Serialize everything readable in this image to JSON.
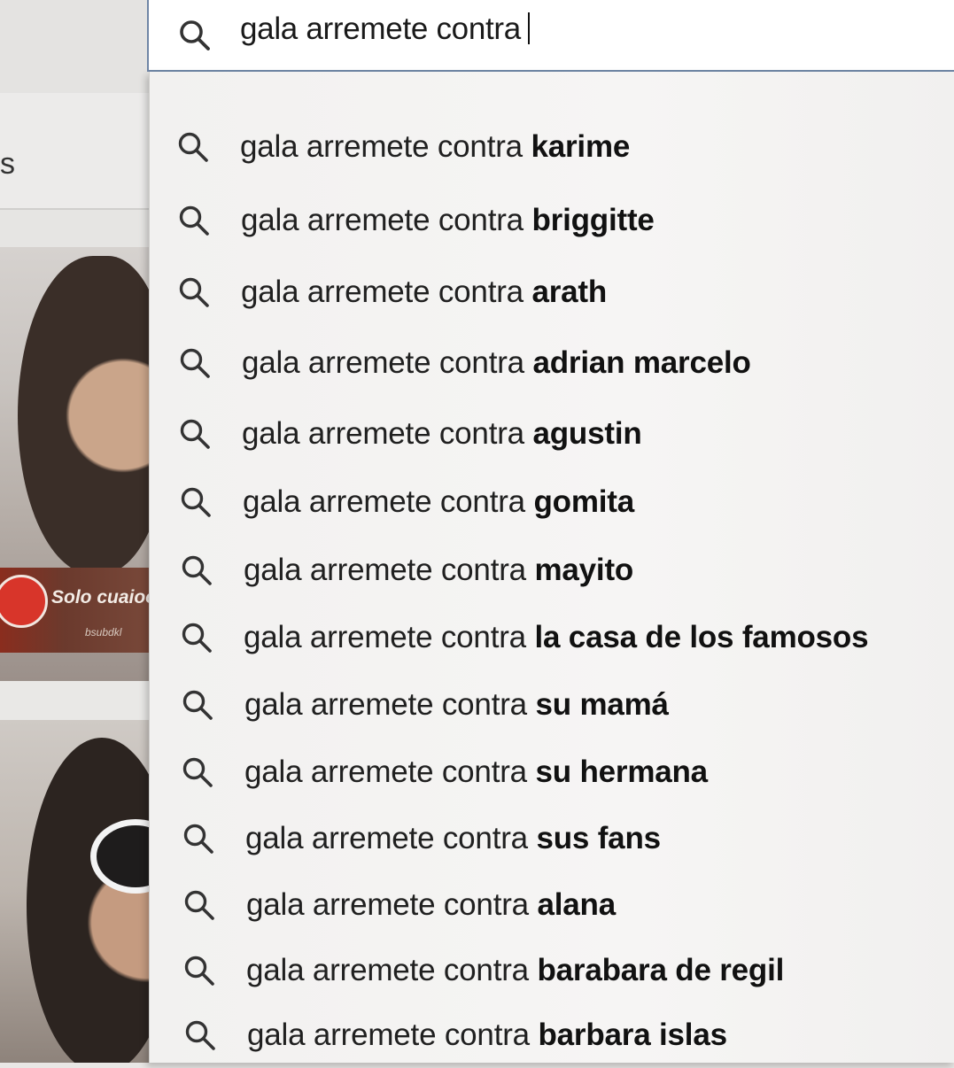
{
  "search": {
    "query": "gala arremete contra"
  },
  "background": {
    "nav_fragment": "s",
    "thumbnail_banner": "Solo cuaioota",
    "thumbnail_banner_sub": "bsubdkl"
  },
  "suggestions": [
    {
      "prefix": "gala arremete contra ",
      "completion": "karime"
    },
    {
      "prefix": "gala arremete contra ",
      "completion": "briggitte"
    },
    {
      "prefix": "gala arremete contra ",
      "completion": "arath"
    },
    {
      "prefix": "gala arremete contra ",
      "completion": "adrian marcelo"
    },
    {
      "prefix": "gala arremete contra ",
      "completion": "agustin"
    },
    {
      "prefix": "gala arremete contra ",
      "completion": "gomita"
    },
    {
      "prefix": "gala arremete contra ",
      "completion": "mayito"
    },
    {
      "prefix": "gala arremete contra ",
      "completion": "la casa de los famosos"
    },
    {
      "prefix": "gala arremete contra ",
      "completion": "su mamá"
    },
    {
      "prefix": "gala arremete contra ",
      "completion": "su hermana"
    },
    {
      "prefix": "gala arremete contra ",
      "completion": "sus fans"
    },
    {
      "prefix": "gala arremete contra ",
      "completion": "alana"
    },
    {
      "prefix": "gala arremete contra ",
      "completion": "barabara de regil"
    },
    {
      "prefix": "gala arremete contra ",
      "completion": "barbara islas"
    }
  ],
  "colors": {
    "search_border": "#6f86a6",
    "dropdown_bg": "#f4f3f2",
    "text": "#1a1a1a"
  },
  "icons": {
    "search": "search-icon"
  }
}
